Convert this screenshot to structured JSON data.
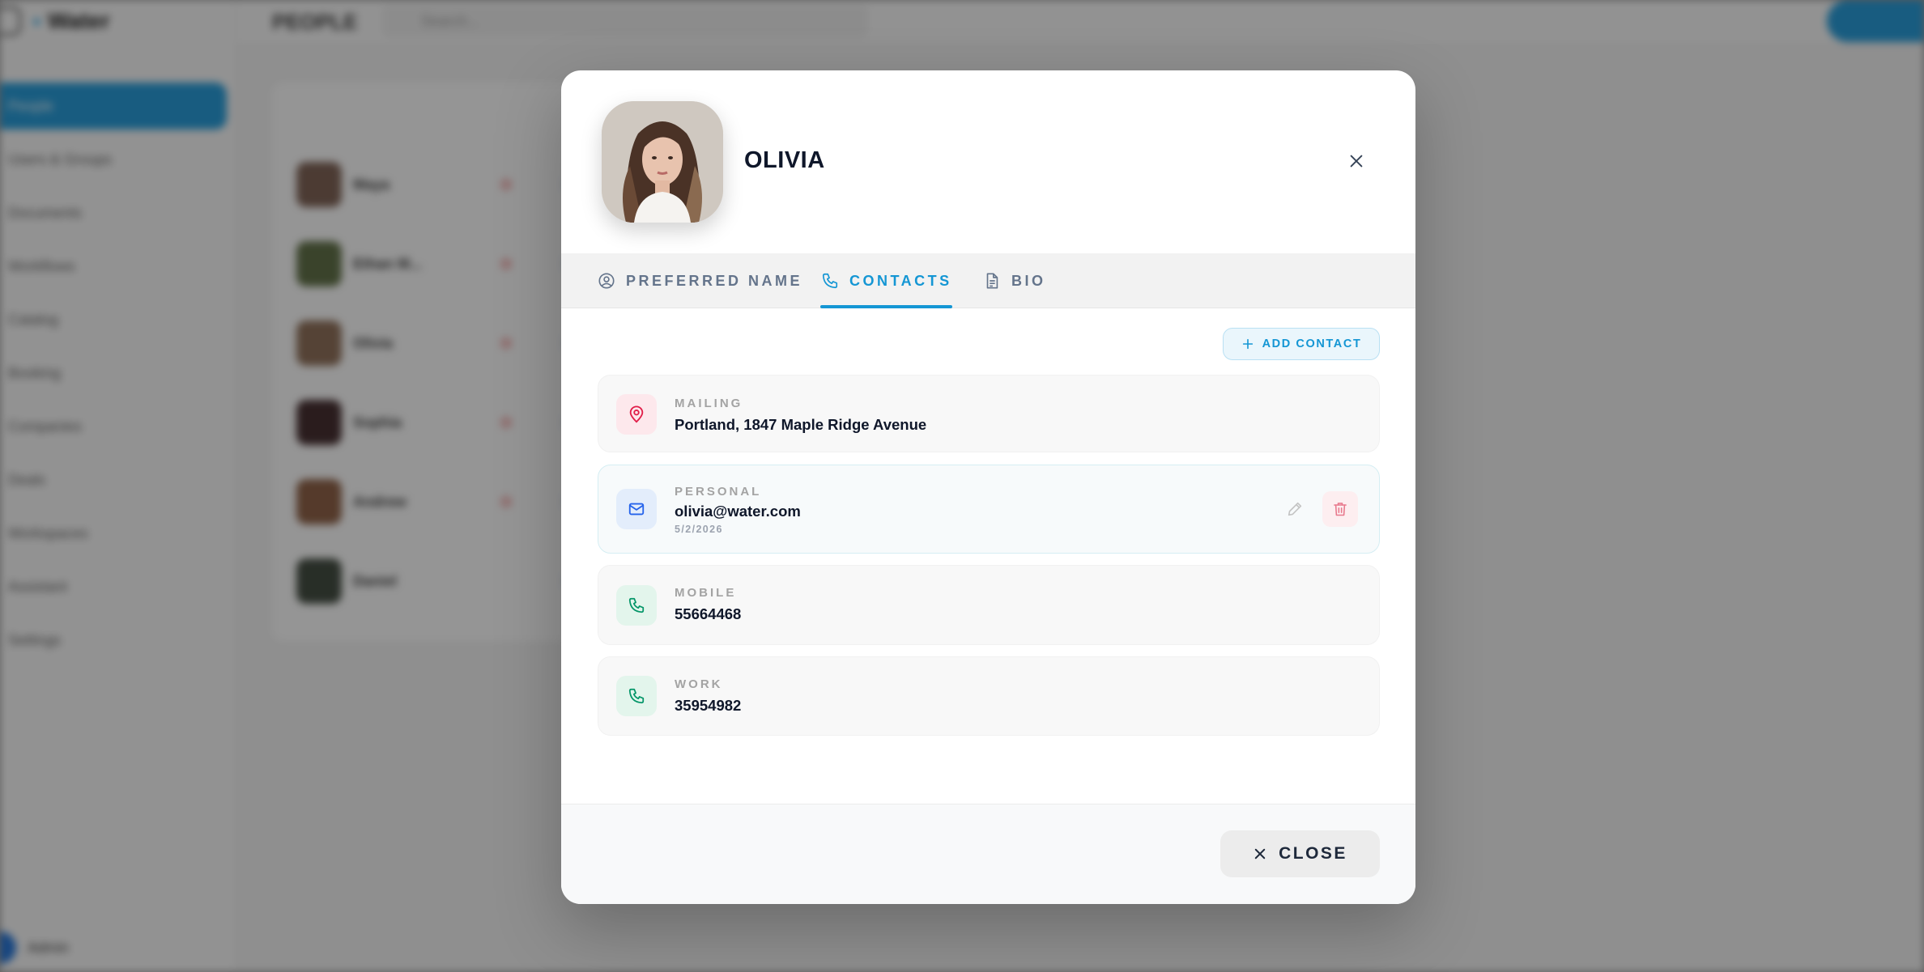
{
  "background": {
    "app_name": "Water",
    "page_title": "PEOPLE",
    "search_placeholder": "Search...",
    "nav": [
      "People",
      "Users & Groups",
      "Documents",
      "Workflows",
      "Catalog",
      "Booking",
      "Companies",
      "Deals",
      "Workspaces",
      "Assistant",
      "Settings"
    ],
    "user": "Admin",
    "list": [
      "Maya",
      "Ethan M...",
      "Olivia",
      "Sophia",
      "Andrew",
      "Daniel"
    ]
  },
  "modal": {
    "title": "OLIVIA",
    "tabs": [
      {
        "label": "PREFERRED NAME",
        "icon": "user-circle-icon"
      },
      {
        "label": "CONTACTS",
        "icon": "phone-icon"
      },
      {
        "label": "BIO",
        "icon": "document-icon"
      }
    ],
    "active_tab": "CONTACTS",
    "add_contact_label": "ADD CONTACT",
    "contacts": [
      {
        "type": "MAILING",
        "value": "Portland, 1847 Maple Ridge Avenue",
        "icon": "map-pin-icon",
        "color": "#e11d48"
      },
      {
        "type": "PERSONAL",
        "value": "olivia@water.com",
        "date": "5/2/2026",
        "icon": "mail-icon",
        "color": "#2563eb"
      },
      {
        "type": "MOBILE",
        "value": "55664468",
        "icon": "phone-icon",
        "color": "#059669"
      },
      {
        "type": "WORK",
        "value": "35954982",
        "icon": "phone-icon",
        "color": "#059669"
      }
    ],
    "close_label": "CLOSE",
    "accent": "#1496d4"
  }
}
